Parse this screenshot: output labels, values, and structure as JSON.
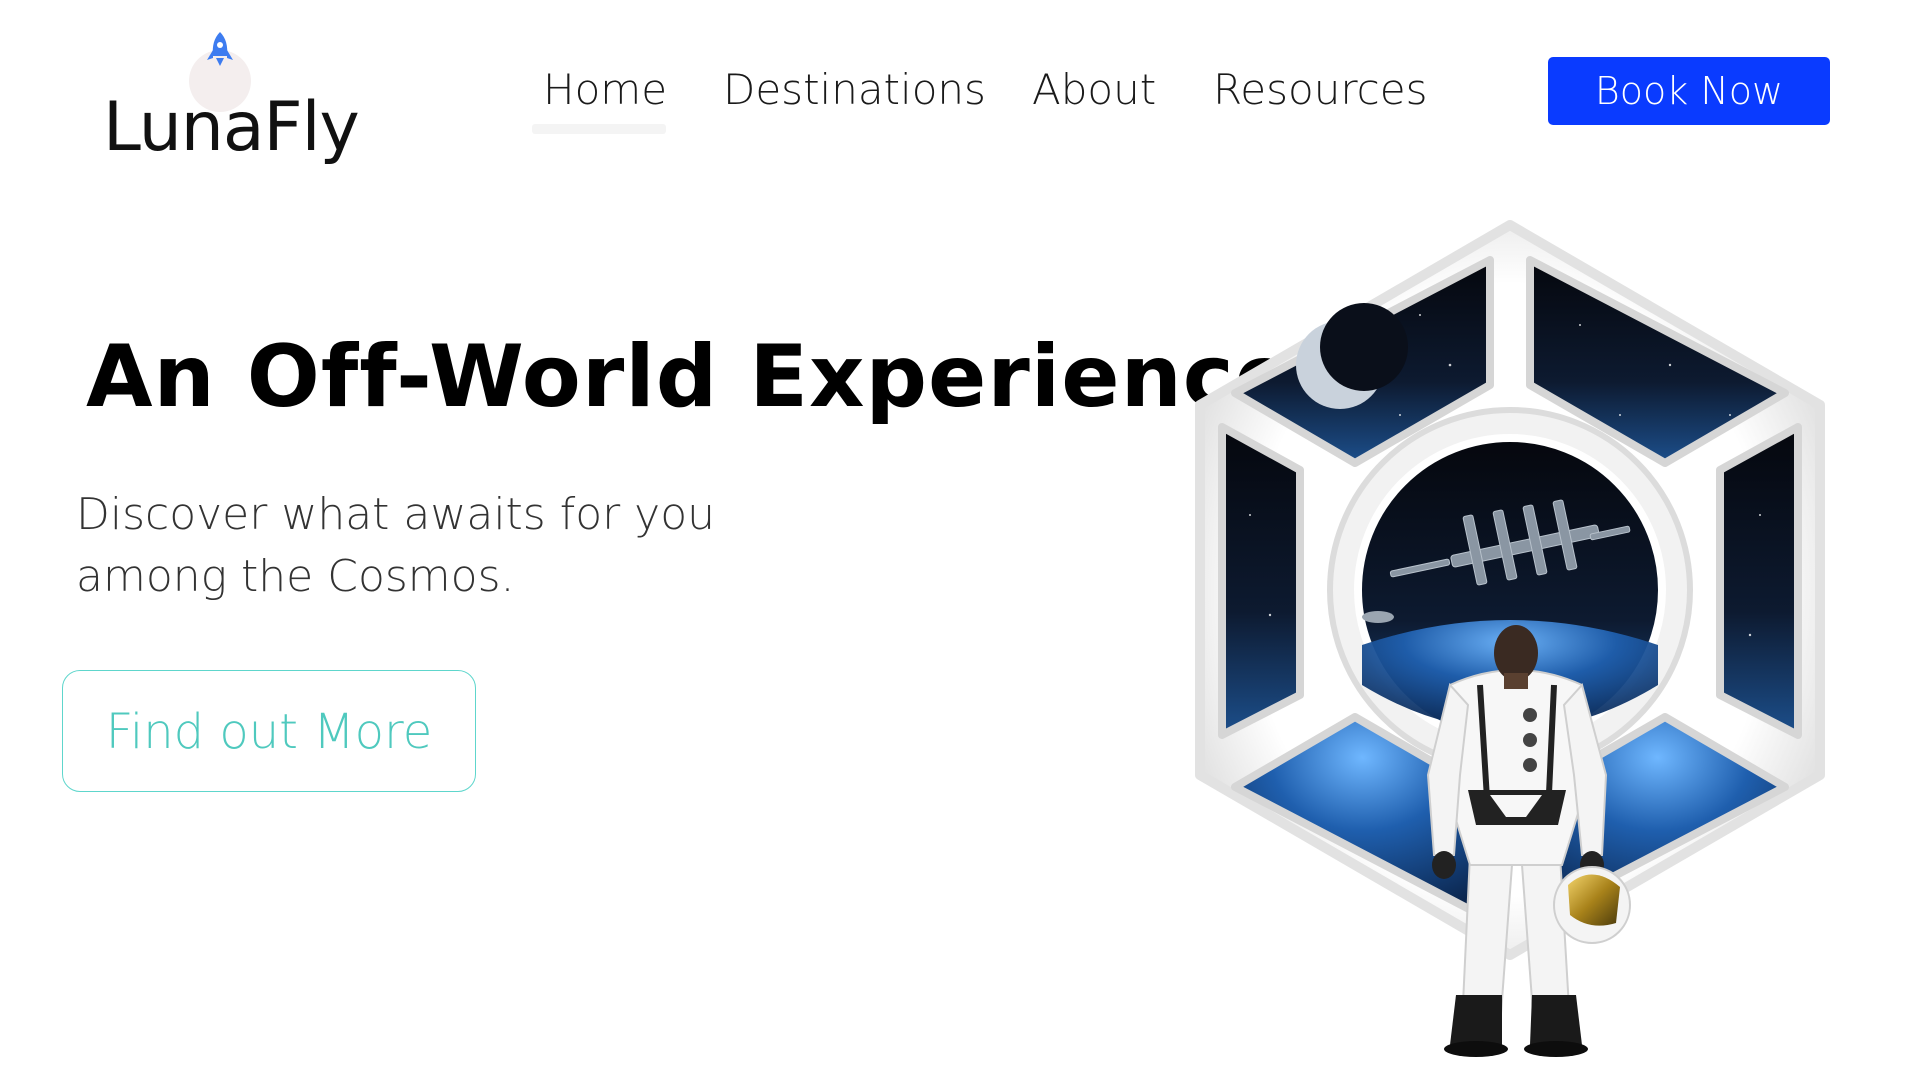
{
  "brand": {
    "name": "LunaFly",
    "logo_icon": "rocket-icon",
    "accent_color": "#3d7cf0"
  },
  "nav": {
    "items": [
      {
        "label": "Home",
        "active": true
      },
      {
        "label": "Destinations",
        "active": false
      },
      {
        "label": "About",
        "active": false
      },
      {
        "label": "Resources",
        "active": false
      }
    ]
  },
  "header": {
    "book_label": "Book Now",
    "book_color": "#0a3bff"
  },
  "hero": {
    "title": "An Off-World Experience",
    "subtitle_line1": "Discover what awaits for you",
    "subtitle_line2": "among the Cosmos.",
    "cta_label": "Find out More",
    "cta_color": "#4fc9be"
  },
  "illustration": {
    "subject": "astronaut-at-hexagonal-viewport-icon"
  }
}
